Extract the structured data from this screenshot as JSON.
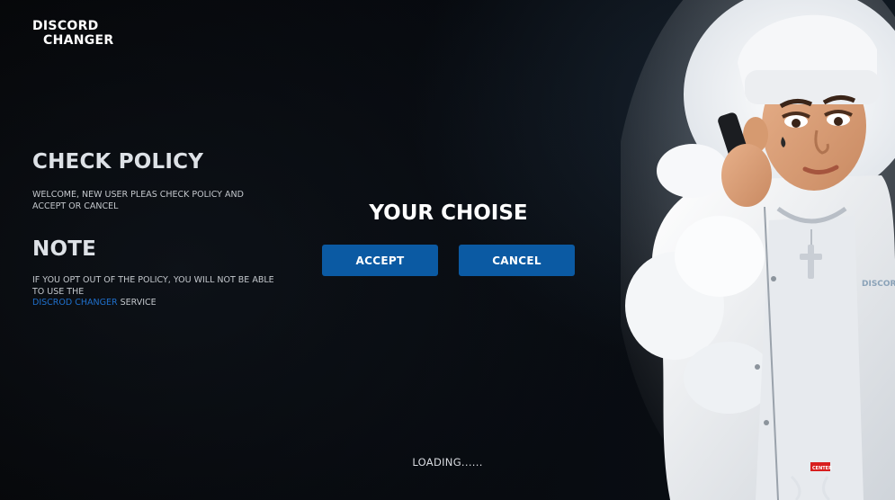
{
  "brand": {
    "line1": "DISCORD",
    "line2": "CHANGER"
  },
  "policy": {
    "title": "CHECK POLICY",
    "text": "WELCOME, NEW USER PLEAS CHECK POLICY AND ACCEPT OR CANCEL"
  },
  "note": {
    "title": "NOTE",
    "text_before": "IF YOU OPT OUT OF THE POLICY, YOU WILL NOT BE ABLE TO USE THE",
    "link": "DISCROD CHANGER",
    "text_after": "SERVICE"
  },
  "choice": {
    "title": "YOUR CHOISE",
    "accept_label": "ACCEPT",
    "cancel_label": "CANCEL"
  },
  "status": {
    "loading": "LOADING......"
  },
  "character": {
    "jacket_text": "DISCORD CHANGER",
    "tag_text": "CENTER"
  },
  "colors": {
    "accent": "#0b5aa3",
    "link": "#1f6fcb",
    "background": "#06080c"
  }
}
